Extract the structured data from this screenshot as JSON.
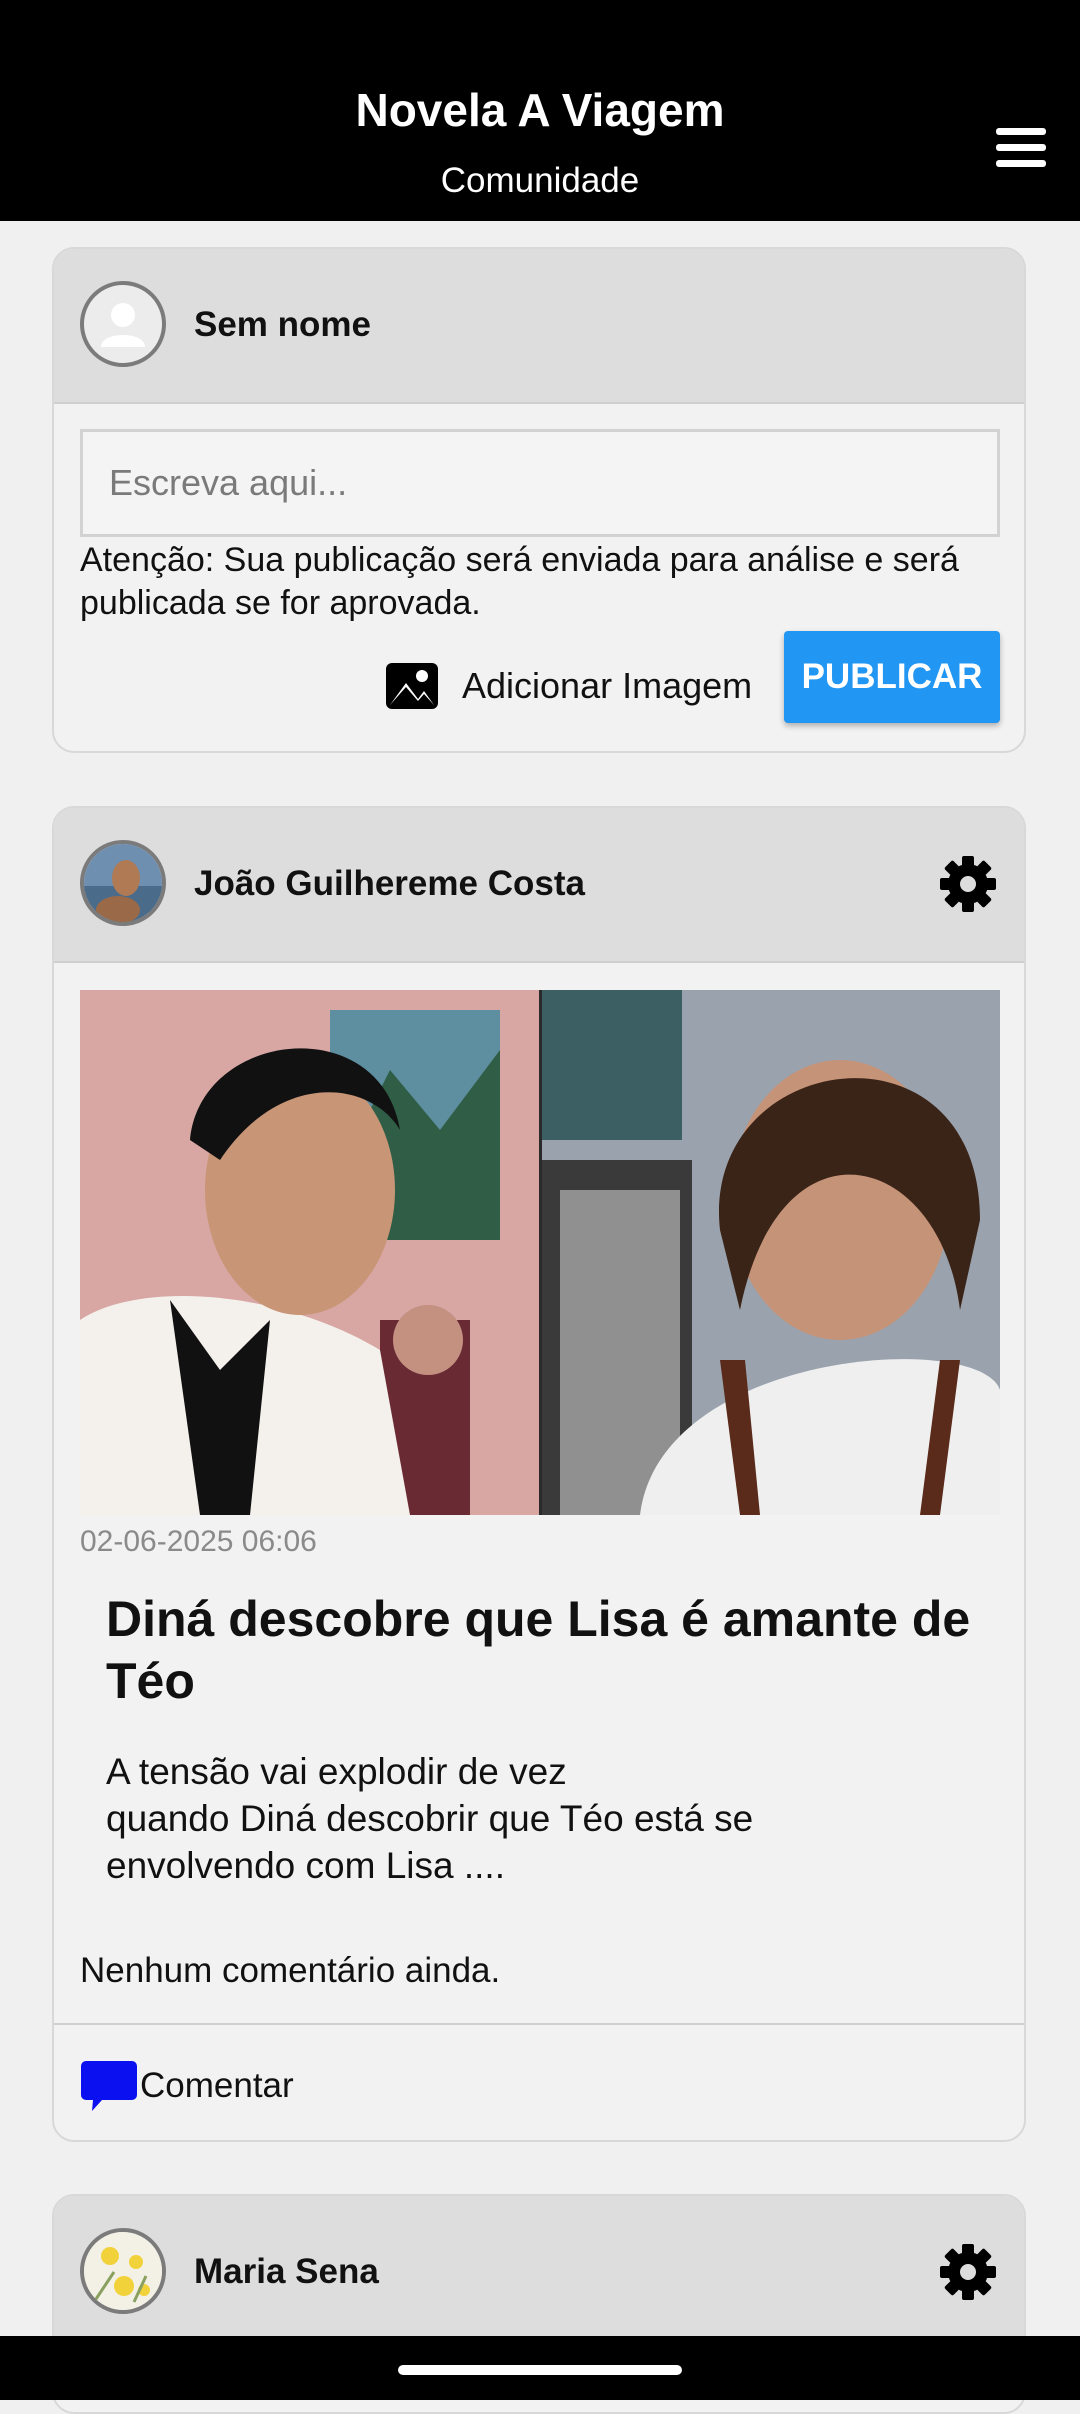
{
  "header": {
    "title": "Novela A Viagem",
    "subtitle": "Comunidade",
    "menu_icon": "hamburger-menu-icon"
  },
  "composer": {
    "username": "Sem nome",
    "avatar_icon": "default-user-icon",
    "input_placeholder": "Escreva aqui...",
    "input_value": "",
    "notice": "Atenção: Sua publicação será enviada para análise e será publicada se for aprovada.",
    "add_image_label": "Adicionar Imagem",
    "add_image_icon": "image-icon",
    "publish_label": "PUBLICAR"
  },
  "posts": [
    {
      "author": "João Guilhereme Costa",
      "settings_icon": "gear-icon",
      "timestamp": "02-06-2025 06:06",
      "title": "Diná descobre que Lisa é amante de Téo",
      "body": "A tensão vai explodir de vez\nquando Diná descobrir que Téo  está se envolvendo com Lisa ....",
      "comments_status": "Nenhum comentário ainda.",
      "comment_label": "Comentar",
      "comment_icon": "speech-bubble-icon"
    },
    {
      "author": "Maria Sena",
      "settings_icon": "gear-icon"
    }
  ],
  "colors": {
    "header_bg": "#000000",
    "publish_button": "#2196f3",
    "comment_icon": "#0a10f0",
    "card_header": "#dddddd"
  }
}
